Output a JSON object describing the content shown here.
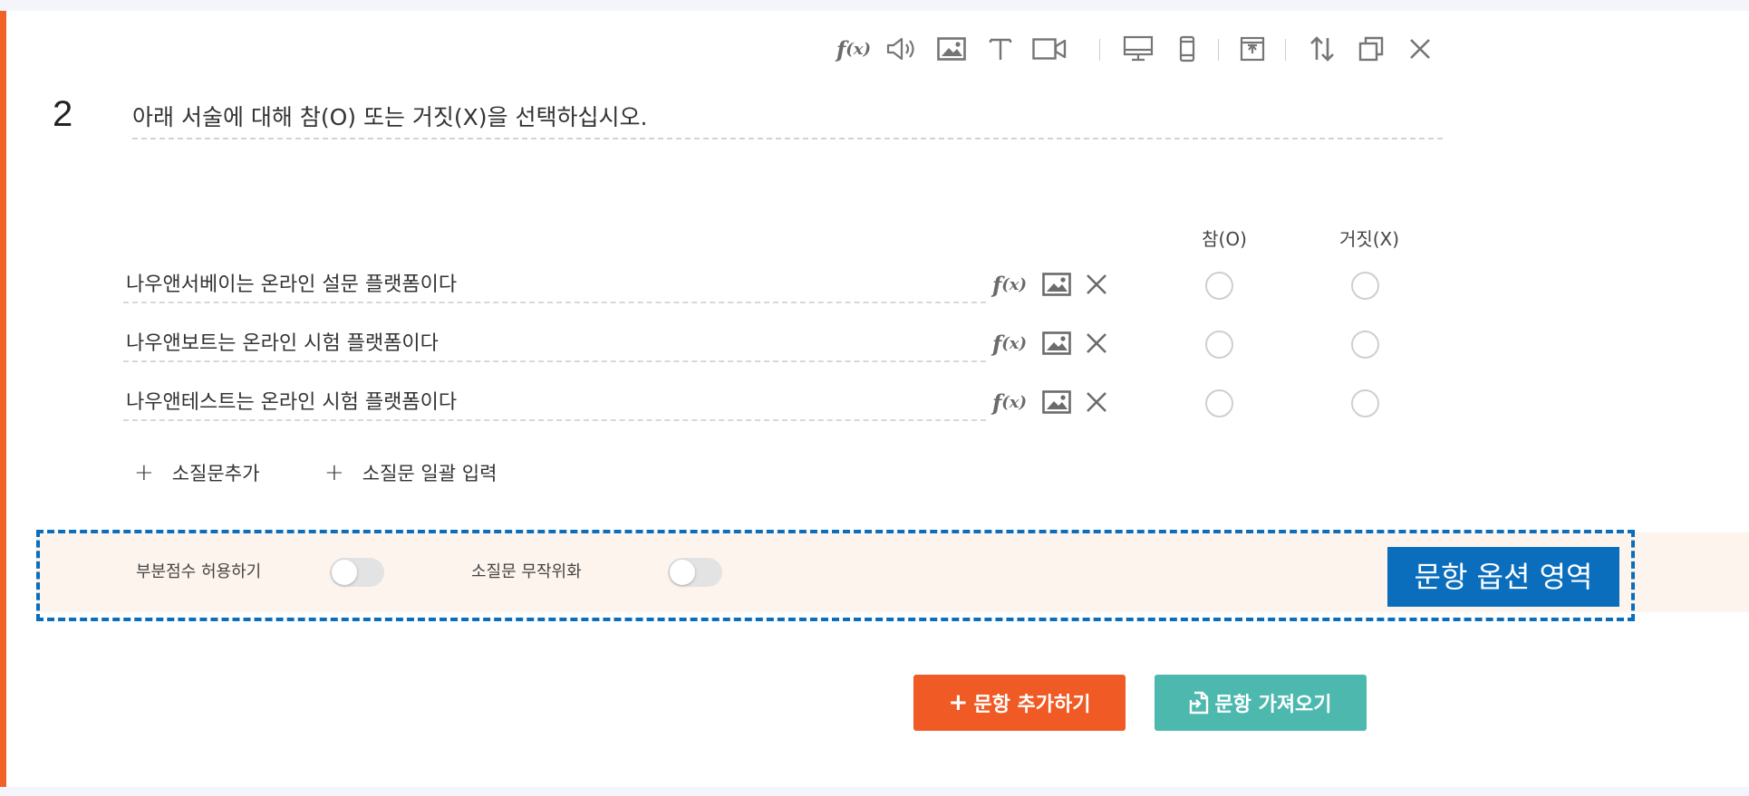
{
  "question": {
    "number": "2",
    "text": "아래 서술에 대해 참(O) 또는 거짓(X)을 선택하십시오."
  },
  "toolbar": {
    "icons": [
      "formula-icon",
      "audio-icon",
      "image-icon",
      "text-icon",
      "video-icon",
      "desktop-icon",
      "mobile-icon",
      "layout-icon",
      "reorder-icon",
      "copy-icon",
      "close-icon"
    ],
    "formula_f": "f",
    "formula_x": "(x)"
  },
  "columns": {
    "true_label": "참(O)",
    "false_label": "거짓(X)"
  },
  "rows": [
    {
      "label": "나우앤서베이는 온라인 설문 플랫폼이다",
      "true_selected": false,
      "false_selected": false
    },
    {
      "label": "나우앤보트는 온라인 시험 플랫폼이다",
      "true_selected": false,
      "false_selected": false
    },
    {
      "label": "나우앤테스트는 온라인 시험 플랫폼이다",
      "true_selected": false,
      "false_selected": false
    }
  ],
  "row_icons": {
    "formula_f": "f",
    "formula_x": "(x)"
  },
  "actions": {
    "add_subquestion": "소질문추가",
    "bulk_input": "소질문 일괄 입력",
    "plus": "+"
  },
  "options": {
    "partial_score_label": "부분점수 허용하기",
    "partial_score_on": false,
    "randomize_label": "소질문 무작위화",
    "randomize_on": false,
    "area_tag": "문항 옵션 영역"
  },
  "buttons": {
    "add_question": "문항 추가하기",
    "import_question": "문항 가져오기",
    "add_plus": "+"
  },
  "colors": {
    "accent": "#f0622a",
    "add_button": "#f05a24",
    "import_button": "#4db8ae",
    "highlight": "#0a6ebd",
    "options_band": "#fdf4ee"
  }
}
